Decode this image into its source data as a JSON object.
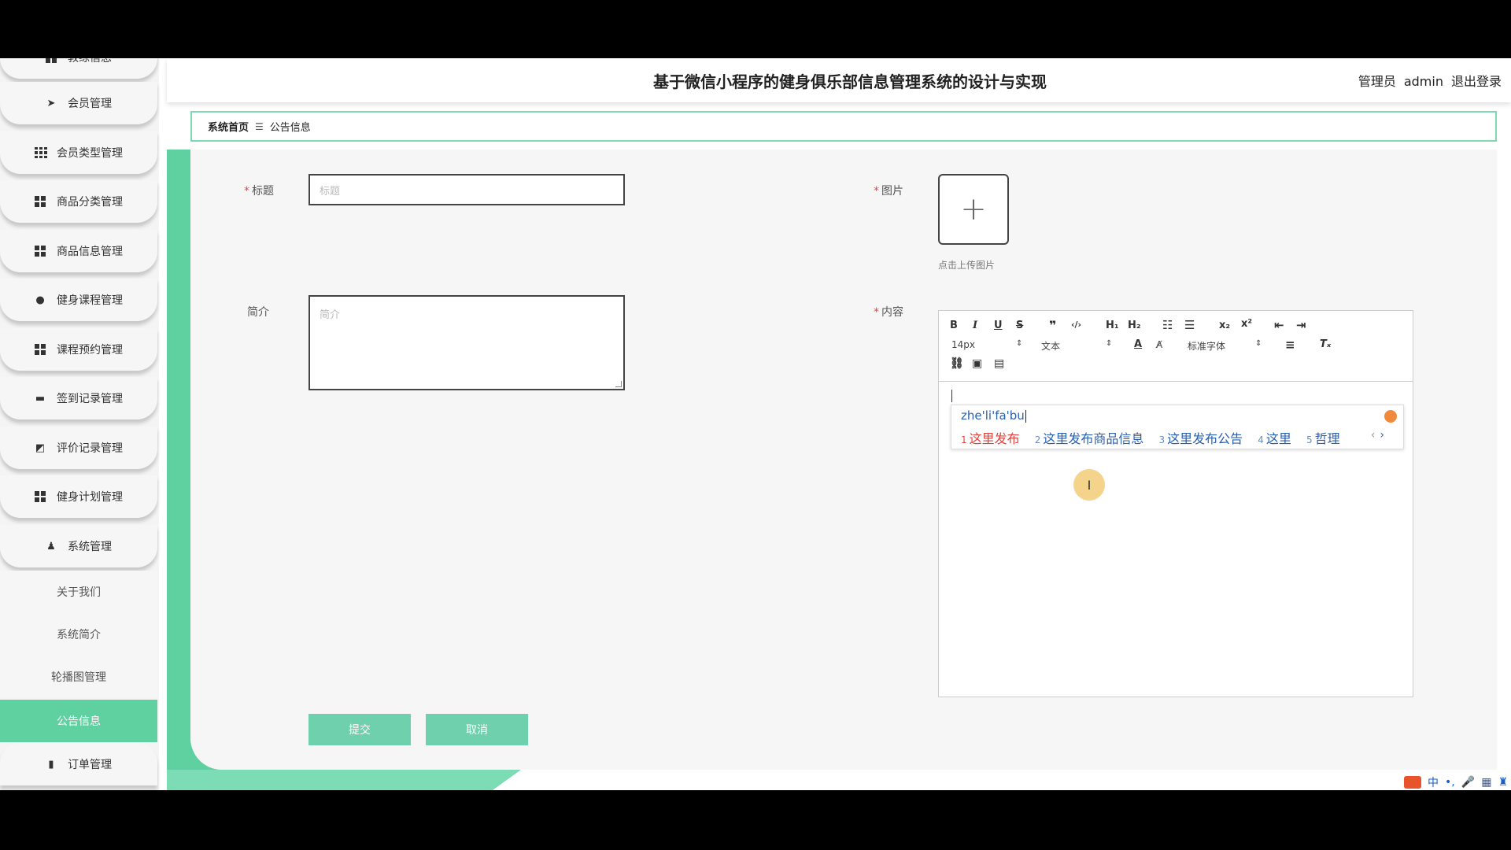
{
  "header": {
    "title": "基于微信小程序的健身俱乐部信息管理系统的设计与实现",
    "role": "管理员",
    "username": "admin",
    "logout": "退出登录"
  },
  "sidebar": {
    "top_partial_label": "教练信息",
    "items": [
      {
        "label": "会员管理",
        "icon": "send-icon"
      },
      {
        "label": "会员类型管理",
        "icon": "grid-icon"
      },
      {
        "label": "商品分类管理",
        "icon": "grid-icon"
      },
      {
        "label": "商品信息管理",
        "icon": "grid-icon"
      },
      {
        "label": "健身课程管理",
        "icon": "lightbulb-icon"
      },
      {
        "label": "课程预约管理",
        "icon": "grid-icon"
      },
      {
        "label": "签到记录管理",
        "icon": "monitor-icon"
      },
      {
        "label": "评价记录管理",
        "icon": "chart-icon"
      },
      {
        "label": "健身计划管理",
        "icon": "grid-icon"
      },
      {
        "label": "系统管理",
        "icon": "user-icon"
      }
    ],
    "subitems": [
      "关于我们",
      "系统简介",
      "轮播图管理",
      "公告信息"
    ],
    "active_subitem": "公告信息",
    "bottom_item": {
      "label": "订单管理",
      "icon": "bar-chart-icon"
    }
  },
  "breadcrumb": {
    "home": "系统首页",
    "separator": "☰",
    "current": "公告信息"
  },
  "form": {
    "title_label": "标题",
    "title_placeholder": "标题",
    "intro_label": "简介",
    "intro_placeholder": "简介",
    "image_label": "图片",
    "upload_hint": "点击上传图片",
    "content_label": "内容",
    "submit": "提交",
    "cancel": "取消"
  },
  "editor": {
    "font_size": "14px",
    "paragraph": "文本",
    "font_family": "标准字体"
  },
  "ime": {
    "composition": "zhe'li'fa'bu",
    "candidates": [
      {
        "n": "1",
        "text": "这里发布"
      },
      {
        "n": "2",
        "text": "这里发布商品信息"
      },
      {
        "n": "3",
        "text": "这里发布公告"
      },
      {
        "n": "4",
        "text": "这里"
      },
      {
        "n": "5",
        "text": "哲理"
      }
    ]
  },
  "tray": {
    "lang": "中"
  },
  "colors": {
    "accent": "#5fd0a0",
    "required": "#e5484d"
  }
}
